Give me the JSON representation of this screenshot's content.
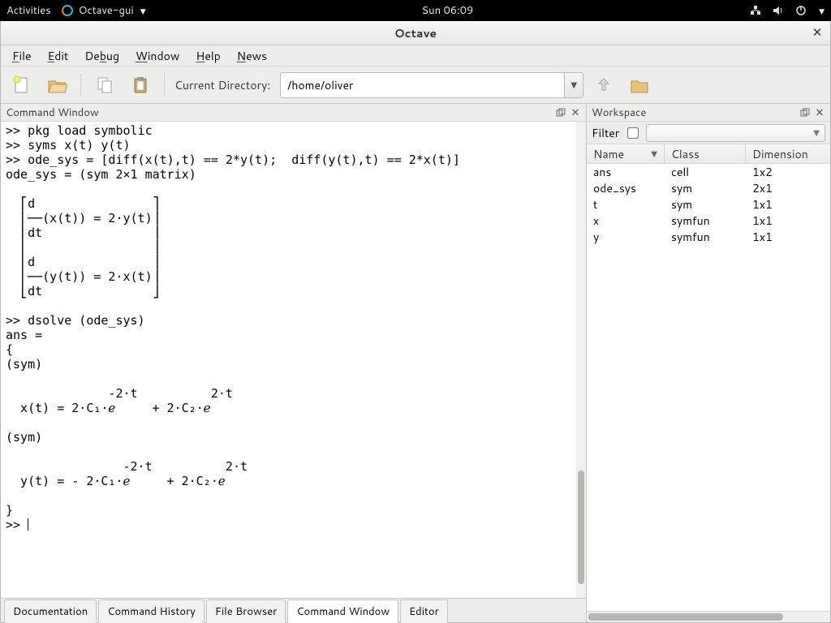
{
  "topbar": {
    "activities": "Activities",
    "app_name": "Octave-gui",
    "clock": "Sun 06:09"
  },
  "window": {
    "title": "Octave"
  },
  "menu": {
    "file": "File",
    "file_u": "F",
    "edit": "Edit",
    "edit_u": "E",
    "debug": "Debug",
    "debug_u": "b",
    "window": "Window",
    "window_u": "W",
    "help": "Help",
    "help_u": "H",
    "news": "News",
    "news_u": "N"
  },
  "toolbar": {
    "curdir_label": "Current Directory:",
    "curdir_value": "/home/oliver"
  },
  "left_pane": {
    "title": "Command Window"
  },
  "console_text": ">> pkg load symbolic\n>> syms x(t) y(t)\n>> ode_sys = [diff(x(t),t) == 2*y(t);  diff(y(t),t) == 2*x(t)]\node_sys = (sym 2×1 matrix)\n\n  ⎡d                ⎤\n  ⎢──(x(t)) = 2⋅y(t)⎥\n  ⎢dt               ⎥\n  ⎢                 ⎥\n  ⎢d                ⎥\n  ⎢──(y(t)) = 2⋅x(t)⎥\n  ⎣dt               ⎦\n\n>> dsolve (ode_sys)\nans =\n{\n(sym)\n\n              -2⋅t          2⋅t\n  x(t) = 2⋅C₁⋅ℯ     + 2⋅C₂⋅ℯ\n\n(sym)\n\n                -2⋅t          2⋅t\n  y(t) = - 2⋅C₁⋅ℯ     + 2⋅C₂⋅ℯ\n\n}\n>> ",
  "bottom_tabs": {
    "documentation": "Documentation",
    "command_history": "Command History",
    "file_browser": "File Browser",
    "command_window": "Command Window",
    "editor": "Editor",
    "active": "command_window"
  },
  "workspace": {
    "title": "Workspace",
    "filter_label": "Filter",
    "columns": {
      "name": "Name",
      "class": "Class",
      "dimension": "Dimension"
    },
    "rows": [
      {
        "name": "ans",
        "class": "cell",
        "dimension": "1x2"
      },
      {
        "name": "ode_sys",
        "class": "sym",
        "dimension": "2x1"
      },
      {
        "name": "t",
        "class": "sym",
        "dimension": "1x1"
      },
      {
        "name": "x",
        "class": "symfun",
        "dimension": "1x1"
      },
      {
        "name": "y",
        "class": "symfun",
        "dimension": "1x1"
      }
    ]
  }
}
